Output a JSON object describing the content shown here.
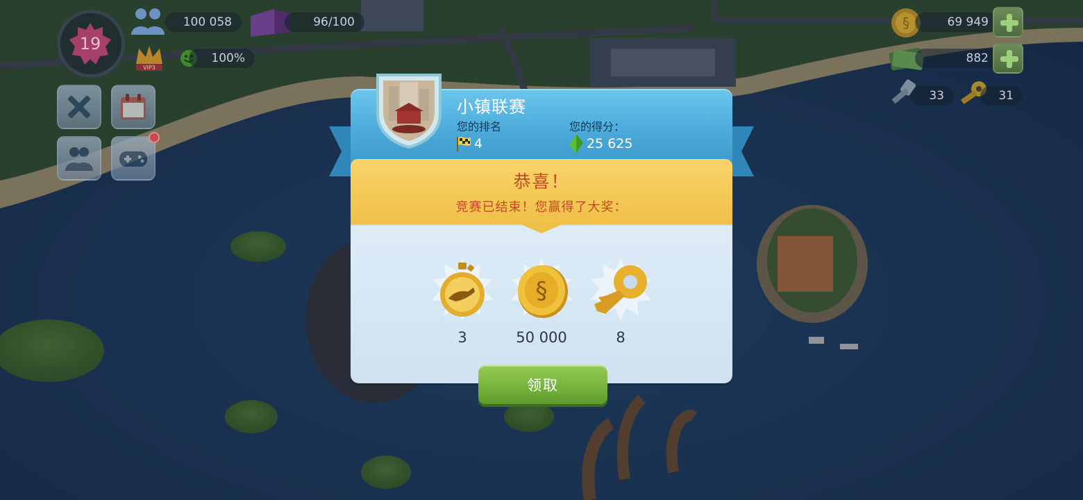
{
  "hud": {
    "level": "19",
    "population": "100 058",
    "storage": "96/100",
    "happiness": "100%",
    "simoleons": "69 949",
    "simcash": "882",
    "platinum_keys": "33",
    "golden_keys": "31",
    "vip_label": "VIP3"
  },
  "dialog": {
    "league_title": "小镇联赛",
    "rank_label": "您的排名",
    "rank_value": "4",
    "score_label": "您的得分：",
    "score_value": "25 625",
    "congrats": "恭喜！",
    "message": "竞赛已结束！您赢得了大奖：",
    "rewards": [
      {
        "icon": "speedup-stopwatch-icon",
        "qty": "3"
      },
      {
        "icon": "simoleon-coin-icon",
        "qty": "50 000"
      },
      {
        "icon": "golden-key-icon",
        "qty": "8"
      }
    ],
    "claim_label": "领取"
  },
  "colors": {
    "header_blue": "#4aa9d9",
    "banner_yellow": "#f5cb58",
    "body_light": "#ddecf7",
    "claim_green": "#7ab83f",
    "message_red": "#c24a21"
  }
}
